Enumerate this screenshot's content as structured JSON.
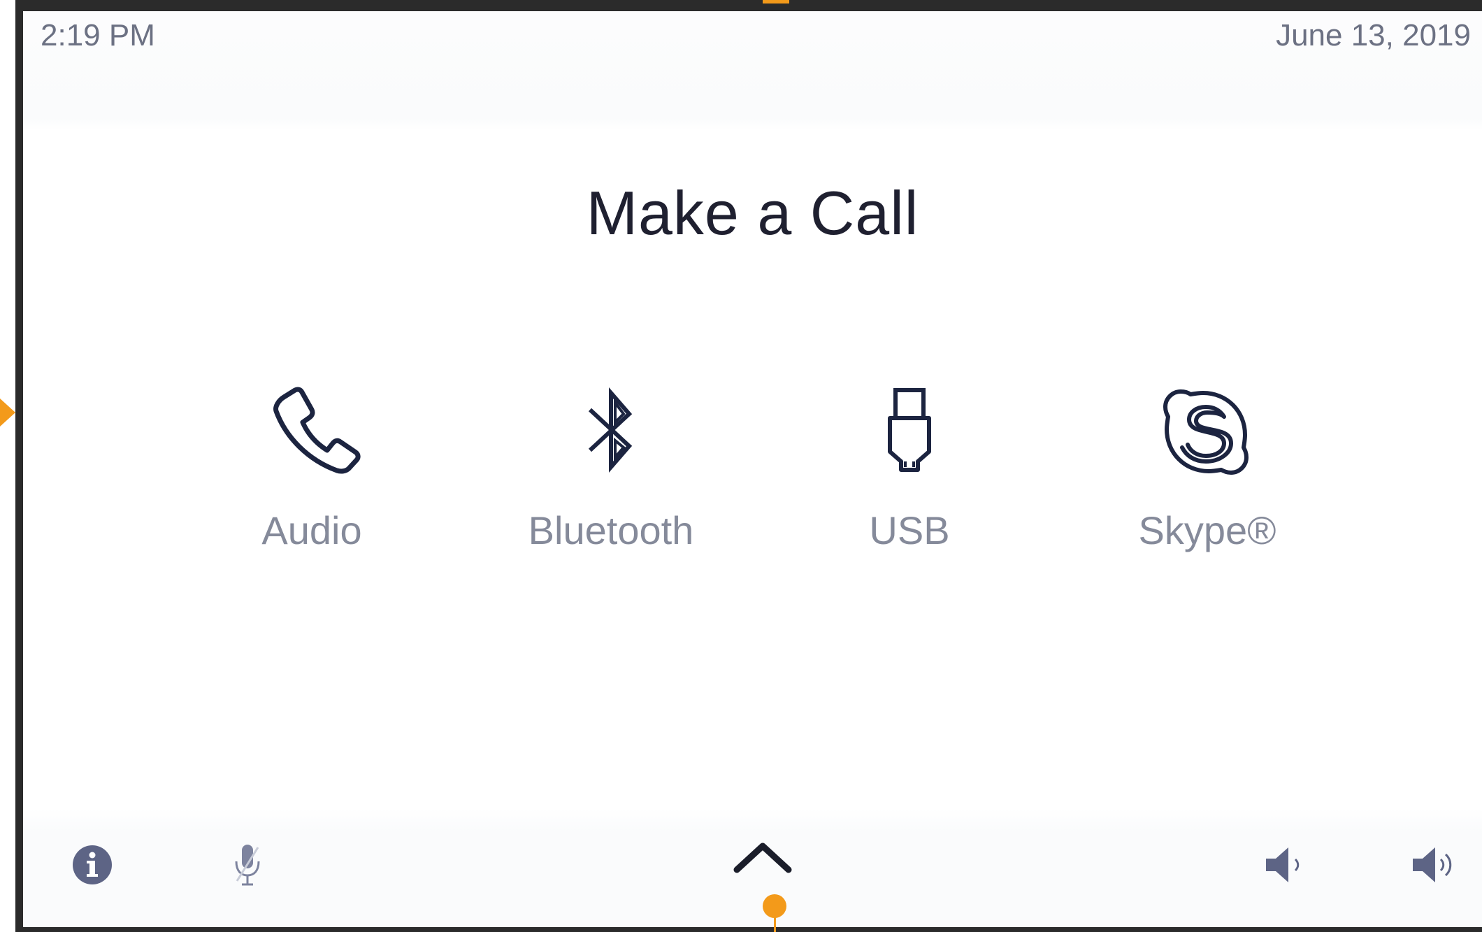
{
  "status_bar": {
    "time": "2:19 PM",
    "date": "June 13, 2019"
  },
  "main": {
    "title": "Make a Call",
    "options": [
      {
        "label": "Audio",
        "icon": "phone-icon"
      },
      {
        "label": "Bluetooth",
        "icon": "bluetooth-icon"
      },
      {
        "label": "USB",
        "icon": "usb-icon"
      },
      {
        "label": "Skype®",
        "icon": "skype-icon"
      }
    ]
  },
  "bottom_bar": {
    "icons": [
      "info-icon",
      "microphone-icon",
      "chevron-up-icon",
      "volume-down-icon",
      "volume-up-icon"
    ]
  },
  "colors": {
    "title": "#1f2030",
    "label": "#858a9a",
    "icon_stroke": "#1c2440",
    "status_text": "#6c7183",
    "marker": "#f39a1a"
  }
}
